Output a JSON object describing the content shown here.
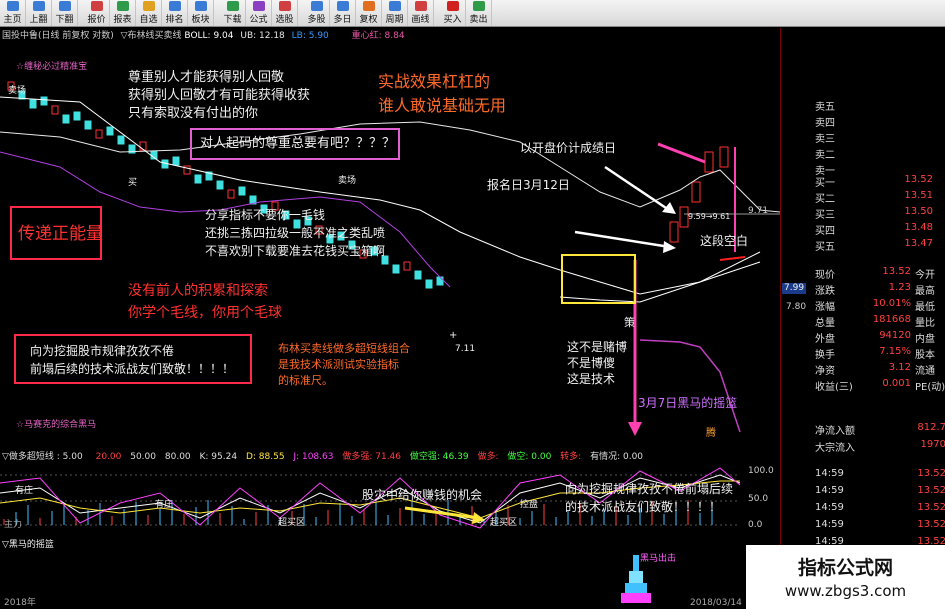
{
  "toolbar": {
    "buttons": [
      {
        "label": "主页",
        "icon": "home-icon",
        "color": "#3a7bd5"
      },
      {
        "label": "上翻",
        "icon": "page-up-icon",
        "color": "#3a7bd5"
      },
      {
        "label": "下翻",
        "icon": "page-down-icon",
        "color": "#3a7bd5"
      },
      {
        "label": "报价",
        "icon": "quote-icon",
        "color": "#d04040"
      },
      {
        "label": "报表",
        "icon": "report-icon",
        "color": "#2e9a4a"
      },
      {
        "label": "自选",
        "icon": "favorites-icon",
        "color": "#e0a020"
      },
      {
        "label": "排名",
        "icon": "ranking-icon",
        "color": "#3a7bd5"
      },
      {
        "label": "板块",
        "icon": "sector-icon",
        "color": "#3a7bd5"
      },
      {
        "label": "下载",
        "icon": "download-icon",
        "color": "#2e9a4a"
      },
      {
        "label": "公式",
        "icon": "formula-icon",
        "color": "#8a40c0"
      },
      {
        "label": "选股",
        "icon": "stock-picker-icon",
        "color": "#d04040"
      },
      {
        "label": "多股",
        "icon": "multi-stock-icon",
        "color": "#3a7bd5"
      },
      {
        "label": "多日",
        "icon": "multi-day-icon",
        "color": "#3a7bd5"
      },
      {
        "label": "复权",
        "icon": "adjust-icon",
        "color": "#e07020"
      },
      {
        "label": "周期",
        "icon": "period-icon",
        "color": "#3a7bd5"
      },
      {
        "label": "画线",
        "icon": "draw-line-icon",
        "color": "#d04040"
      },
      {
        "label": "买入",
        "icon": "buy-icon",
        "color": "#d02020"
      },
      {
        "label": "卖出",
        "icon": "sell-icon",
        "color": "#2e9a4a"
      }
    ]
  },
  "infobar": {
    "stock": "国投中鲁(日线 前复权 对数)",
    "indicator": "▽布林线买卖线",
    "boll": "BOLL: 9.04",
    "ub": "UB: 12.18",
    "lb": "LB: 5.90",
    "right": "重心红: 8.84"
  },
  "chart_labels": {
    "top_small": "☆缠秘必过精准宝",
    "lower_small": "☆马赛克的综合黑马",
    "sell_1": "卖场",
    "buy_1": "买",
    "sell_2": "卖场",
    "price_range": "9.59→9.61",
    "price_low": "7.11",
    "price_971": "9.71",
    "price_799": "7.99",
    "price_780": "7.80",
    "ce": "策",
    "cross_1": "+",
    "bottom_right": "腾"
  },
  "annotations": {
    "respect_1": "尊重别人才能获得别人回敬",
    "respect_2": "获得别人回敬才有可能获得收获",
    "respect_3": "只有索取没有付出的你",
    "effect_1": "实战效果杠杠的",
    "effect_2": "谁人敢说基础无用",
    "basic_respect": "对人起码的尊重总要有吧？？？？",
    "open_price": "以开盘价计成绩日",
    "report_day": "报名日3月12日",
    "gap": "这段空白",
    "positive": "传递正能量",
    "share_1": "分享指标不要你一毛钱",
    "share_2": "还挑三拣四拉级一般不准之类乱喷",
    "share_3": "不喜欢别下载要准去花钱买宝箱啊",
    "pioneers_1": "没有前人的积累和探索",
    "pioneers_2": "你学个毛线，你用个毛球",
    "salute_1": "向为挖掘股市规律孜孜不倦",
    "salute_2": "前塌后续的技术派战友们致敬！！！！",
    "boll_note_1": "布林买卖线做多超短线组合",
    "boll_note_2": "是我技术派测试实验指标",
    "boll_note_3": "的标准尺。",
    "not_gamble_1": "这不是赌博",
    "not_gamble_2": "不是博傻",
    "not_gamble_3": "这是技术",
    "dark_horse": "3月7日黑马的摇篮",
    "disaster": "股灾中给你赚钱的机会",
    "salute2_1": "向为挖掘规律孜孜不倦前塌后续",
    "salute2_2": "的技术派战友们致敬！！！！"
  },
  "indicator_bar": {
    "name": "▽做多超短线 : 5.00",
    "v20": "20.00",
    "v50": "50.00",
    "v80": "80.00",
    "k": "K: 95.24",
    "d": "D: 88.55",
    "j": "J: 108.63",
    "long_dom": "做多强: 71.46",
    "short_dom": "做空强: 46.39",
    "long": "做多:",
    "short": "做空: 0.00",
    "turn": "转多:",
    "chance": "有情况: 0.00"
  },
  "sub_chart": {
    "label_1": "有庄",
    "label_2": "有庄",
    "label_3": "超买区",
    "label_4": "超买区",
    "label_5": "控盘",
    "label_6": "主力",
    "axis_100": "100.0",
    "axis_50": "50.0",
    "axis_0": "0.0",
    "horse_label": "▽黑马的摇篮",
    "horse_title": "黑马出击",
    "date_left": "2018年",
    "date_right": "2018/03/14"
  },
  "right_panel": {
    "sell_labels": [
      "卖五",
      "卖四",
      "卖三",
      "卖二",
      "卖一"
    ],
    "buy_rows": [
      {
        "label": "买一",
        "value": "13.52"
      },
      {
        "label": "买二",
        "value": "13.51"
      },
      {
        "label": "买三",
        "value": "13.50"
      },
      {
        "label": "买四",
        "value": "13.48"
      },
      {
        "label": "买五",
        "value": "13.47"
      }
    ],
    "stats": [
      {
        "label": "现价",
        "value": "13.52",
        "label2": "今开"
      },
      {
        "label": "涨跌",
        "value": "1.23",
        "label2": "最高"
      },
      {
        "label": "涨幅",
        "value": "10.01%",
        "label2": "最低"
      },
      {
        "label": "总量",
        "value": "181668",
        "label2": "量比"
      },
      {
        "label": "外盘",
        "value": "94120",
        "label2": "内盘"
      },
      {
        "label": "换手",
        "value": "7.15%",
        "label2": "股本"
      },
      {
        "label": "净资",
        "value": "3.12",
        "label2": "流通"
      },
      {
        "label": "收益(三)",
        "value": "0.001",
        "label2": "PE(动)"
      }
    ],
    "flow": [
      {
        "label": "净流入额",
        "value": "812.7"
      },
      {
        "label": "大宗流入",
        "value": "1970"
      }
    ],
    "ticks": [
      {
        "time": "14:59",
        "price": "13.52"
      },
      {
        "time": "14:59",
        "price": "13.52"
      },
      {
        "time": "14:59",
        "price": "13.52"
      },
      {
        "time": "14:59",
        "price": "13.52"
      },
      {
        "time": "14:59",
        "price": "13.52"
      }
    ]
  },
  "watermark": {
    "line1": "指标公式网",
    "line2": "www.zbgs3.com"
  }
}
